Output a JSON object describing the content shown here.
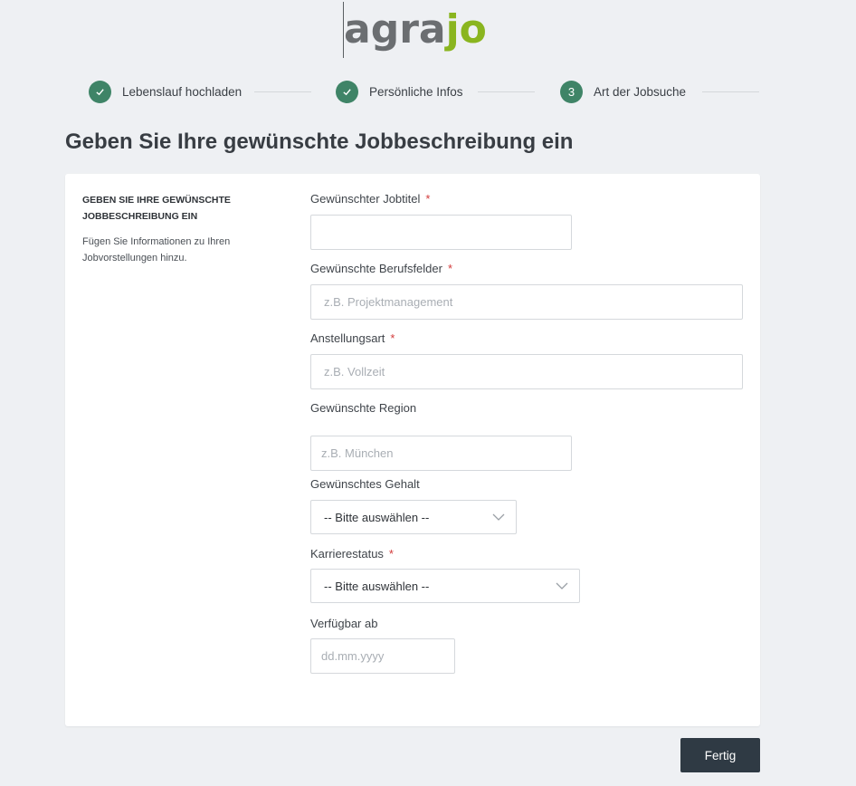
{
  "brand": {
    "prefix": "agra",
    "suffix": "jo"
  },
  "steps": [
    {
      "label": "Lebenslauf hochladen",
      "state": "done",
      "icon": "check-icon"
    },
    {
      "label": "Persönliche Infos",
      "state": "done",
      "icon": "check-icon"
    },
    {
      "label": "Art der Jobsuche",
      "state": "current",
      "number": "3"
    }
  ],
  "page": {
    "title": "Geben Sie Ihre gewünschte Jobbeschreibung ein"
  },
  "sidebar": {
    "title": "GEBEN SIE IHRE GEWÜNSCHTE JOBBESCHREIBUNG EIN",
    "description": "Fügen Sie Informationen zu Ihren Jobvorstellungen hinzu."
  },
  "form": {
    "job_title": {
      "label": "Gewünschter Jobtitel",
      "required": "*",
      "value": "",
      "placeholder": ""
    },
    "fields": {
      "label": "Gewünschte Berufsfelder",
      "required": "*",
      "placeholder": "z.B. Projektmanagement"
    },
    "employment": {
      "label": "Anstellungsart",
      "required": "*",
      "placeholder": "z.B. Vollzeit"
    },
    "region": {
      "label": "Gewünschte Region",
      "placeholder": "z.B. München"
    },
    "salary": {
      "label": "Gewünschtes Gehalt",
      "selected": "-- Bitte auswählen --"
    },
    "career": {
      "label": "Karrierestatus",
      "required": "*",
      "selected": "-- Bitte auswählen --"
    },
    "available": {
      "label": "Verfügbar ab",
      "placeholder": "dd.mm.yyyy"
    }
  },
  "actions": {
    "finish": "Fertig"
  },
  "colors": {
    "accent_green": "#3f8467",
    "brand_green": "#8ab51f",
    "required_red": "#d33a3a",
    "button_dark": "#2f3a44"
  }
}
